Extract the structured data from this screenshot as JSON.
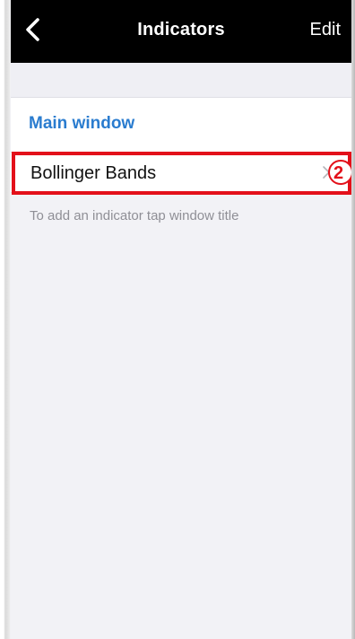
{
  "navbar": {
    "back_icon": "chevron-left-icon",
    "title": "Indicators",
    "edit_label": "Edit"
  },
  "section": {
    "title": "Main window",
    "items": [
      {
        "label": "Bollinger Bands",
        "remove_icon": "close-icon"
      }
    ]
  },
  "hint": "To add an indicator tap window title",
  "annotation": {
    "step_number": "2",
    "highlight_color": "#e3101a"
  },
  "colors": {
    "navbar_bg": "#000000",
    "accent": "#2a7ccf",
    "background": "#f2f2f6"
  }
}
